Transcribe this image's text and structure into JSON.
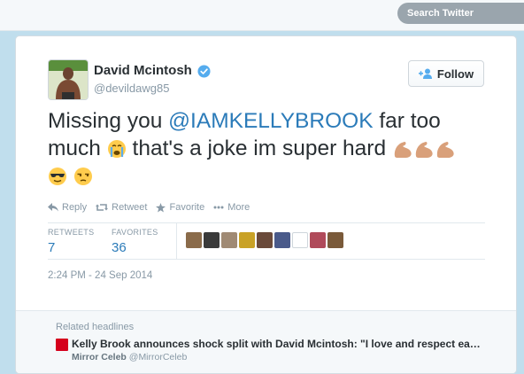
{
  "search": {
    "placeholder": "Search Twitter"
  },
  "tweet": {
    "author_name": "David Mcintosh",
    "author_handle": "@devildawg85",
    "follow_label": "Follow",
    "text_part1": "Missing you ",
    "mention": "@IAMKELLYBROOK",
    "text_part2": " far too much ",
    "text_part3": " that's a joke im super hard ",
    "emojis": [
      "crying-face",
      "flexed-biceps",
      "flexed-biceps",
      "flexed-biceps",
      "smiling-face-with-sunglasses",
      "unamused-face"
    ],
    "actions": {
      "reply": "Reply",
      "retweet": "Retweet",
      "favorite": "Favorite",
      "more": "More"
    },
    "stats": {
      "retweets_label": "RETWEETS",
      "retweets_value": "7",
      "favorites_label": "FAVORITES",
      "favorites_value": "36"
    },
    "timestamp": "2:24 PM - 24 Sep 2014"
  },
  "related": {
    "title": "Related headlines",
    "headline": "Kelly Brook announces shock split with David Mcintosh: \"I love and respect each other\"",
    "source_name": "Mirror Celeb",
    "source_handle": "@MirrorCeleb"
  },
  "colors": {
    "link": "#2b7bb9",
    "verified": "#55acee",
    "muted": "#8899a6",
    "text": "#292f33",
    "mirror_red": "#d5001c"
  }
}
